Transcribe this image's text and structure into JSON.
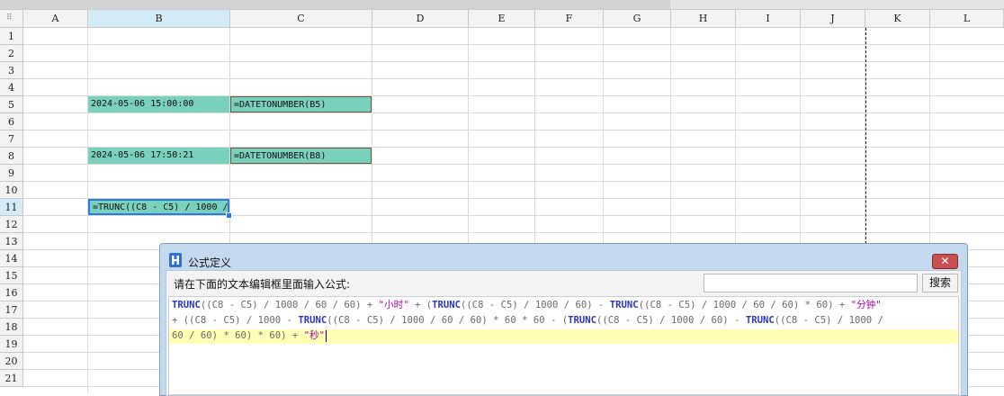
{
  "columns": [
    "A",
    "B",
    "C",
    "D",
    "E",
    "F",
    "G",
    "H",
    "I",
    "J",
    "K",
    "L"
  ],
  "selected_column": "B",
  "rows": [
    "1",
    "2",
    "3",
    "4",
    "5",
    "6",
    "7",
    "8",
    "9",
    "10",
    "11",
    "12",
    "13",
    "14",
    "15",
    "16",
    "17",
    "18",
    "19",
    "20",
    "21"
  ],
  "selected_row": "11",
  "cells": {
    "B5": "2024-05-06 15:00:00",
    "C5": "=DATETONUMBER(B5)",
    "B8": "2024-05-06 17:50:21",
    "C8": "=DATETONUMBER(B8)",
    "B11": "=TRUNC((C8 - C5) / 1000 /"
  },
  "dialog": {
    "title": "公式定义",
    "prompt": "请在下面的文本编辑框里面输入公式:",
    "search_value": "",
    "search_button": "搜索",
    "close_glyph": "✕",
    "formula_lines": [
      [
        {
          "t": "TRUNC",
          "c": "kw"
        },
        {
          "t": "((C8 - C5) / 1000 / 60 / 60) + ",
          "c": "op"
        },
        {
          "t": "\"小时\"",
          "c": "str"
        },
        {
          "t": " + (",
          "c": "op"
        },
        {
          "t": "TRUNC",
          "c": "kw"
        },
        {
          "t": "((C8 - C5) / 1000 / 60) - ",
          "c": "op"
        },
        {
          "t": "TRUNC",
          "c": "kw"
        },
        {
          "t": "((C8 - C5) / 1000 / 60 / 60) * 60) + ",
          "c": "op"
        },
        {
          "t": "\"分钟\"",
          "c": "str"
        }
      ],
      [
        {
          "t": "+ ((C8 - C5) / 1000 - ",
          "c": "op"
        },
        {
          "t": "TRUNC",
          "c": "kw"
        },
        {
          "t": "((C8 - C5) / 1000 / 60 / 60) * 60 * 60 - (",
          "c": "op"
        },
        {
          "t": "TRUNC",
          "c": "kw"
        },
        {
          "t": "((C8 - C5) / 1000 / 60) - ",
          "c": "op"
        },
        {
          "t": "TRUNC",
          "c": "kw"
        },
        {
          "t": "((C8 - C5) / 1000 /",
          "c": "op"
        }
      ],
      [
        {
          "t": "60 / 60) * 60) * 60) + ",
          "c": "op"
        },
        {
          "t": "\"秒\"",
          "c": "str"
        }
      ]
    ]
  },
  "colors": {
    "cell_fill": "#79d0bc",
    "selection": "#2a7ae2",
    "keyword": "#2b35c8",
    "string": "#b000b0",
    "current_line": "#ffffb5"
  }
}
